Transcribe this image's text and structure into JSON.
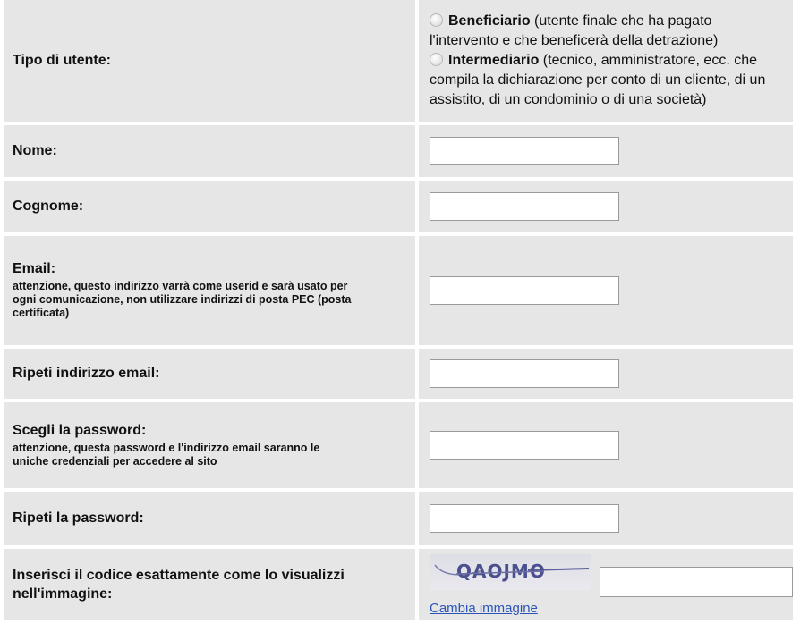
{
  "user_type": {
    "label": "Tipo di utente:",
    "options": [
      {
        "title": "Beneficiario",
        "desc1": " (utente finale che ha pagato",
        "desc2": "l'intervento e che beneficerà della detrazione)"
      },
      {
        "title": "Intermediario",
        "desc1": " (tecnico, amministratore, ecc. che",
        "desc2": "compila la dichiarazione per conto di un cliente, di un",
        "desc3": "assistito, di un condominio o di una società)"
      }
    ]
  },
  "fields": {
    "nome": {
      "label": "Nome:",
      "value": ""
    },
    "cognome": {
      "label": "Cognome:",
      "value": ""
    },
    "email": {
      "label": "Email:",
      "note": "attenzione, questo indirizzo varrà come userid e sarà usato per ogni comunicazione, non utilizzare indirizzi di posta PEC (posta certificata)",
      "value": ""
    },
    "email_repeat": {
      "label": "Ripeti indirizzo email:",
      "value": ""
    },
    "password": {
      "label": "Scegli la password:",
      "note": "attenzione, questa password e l'indirizzo email saranno le uniche credenziali per accedere al sito",
      "value": ""
    },
    "password_repeat": {
      "label": "Ripeti la password:",
      "value": ""
    }
  },
  "captcha": {
    "label": "Inserisci il codice esattamente come lo visualizzi nell'immagine:",
    "image_text": "QAOJMO",
    "change_link": "Cambia immagine",
    "value": ""
  },
  "colors": {
    "cell_bg": "#e6e6e6",
    "link": "#2a55b8"
  }
}
